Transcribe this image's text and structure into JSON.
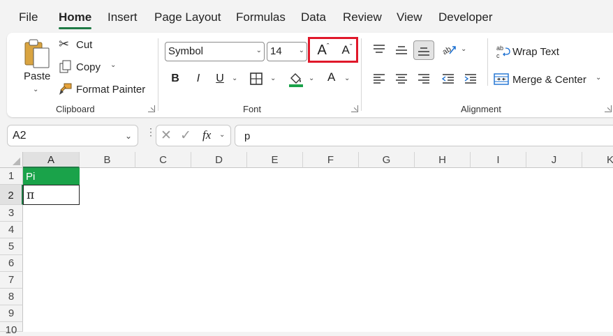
{
  "tabs": [
    "File",
    "Home",
    "Insert",
    "Page Layout",
    "Formulas",
    "Data",
    "Review",
    "View",
    "Developer"
  ],
  "clipboard": {
    "paste": "Paste",
    "cut": "Cut",
    "copy": "Copy",
    "format_painter": "Format Painter",
    "group_label": "Clipboard"
  },
  "font": {
    "name": "Symbol",
    "size": "14",
    "increase_label": "A",
    "decrease_label": "A",
    "bold": "B",
    "italic": "I",
    "underline": "U",
    "color_glyph": "A",
    "group_label": "Font"
  },
  "alignment": {
    "wrap_text": "Wrap Text",
    "merge_center": "Merge & Center",
    "group_label": "Alignment"
  },
  "formula": {
    "namebox": "A2",
    "fx": "fx",
    "content": "p"
  },
  "sheet": {
    "columns": [
      "A",
      "B",
      "C",
      "D",
      "E",
      "F",
      "G",
      "H",
      "I",
      "J",
      "K"
    ],
    "rows": [
      "1",
      "2",
      "3",
      "4",
      "5",
      "6",
      "7",
      "8",
      "9",
      "10"
    ],
    "cells": {
      "A1": "Pi",
      "A2": "π"
    }
  },
  "colors": {
    "accent": "#1f7a45",
    "header_fill": "#1aa34a",
    "highlight": "#e0182a"
  }
}
